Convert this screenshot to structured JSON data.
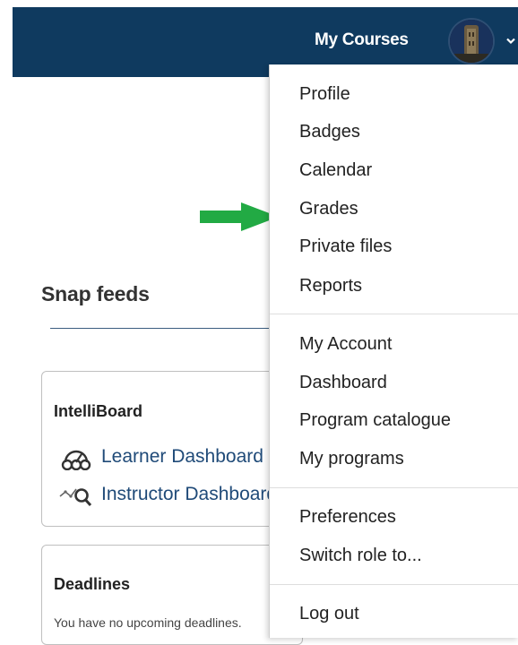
{
  "header": {
    "my_courses_label": "My Courses",
    "avatar_icon": "user-avatar",
    "caret_icon": "chevron-down-icon",
    "background": "#0f3a5f"
  },
  "main": {
    "section_title": "Snap feeds",
    "intelliboard": {
      "title": "IntelliBoard",
      "links": [
        {
          "label": "Learner Dashboard",
          "icon": "dashboard-gauge-icon"
        },
        {
          "label": "Instructor Dashboard",
          "icon": "analytics-magnifier-icon"
        }
      ]
    },
    "deadlines": {
      "title": "Deadlines",
      "empty_text": "You have no upcoming deadlines."
    }
  },
  "annotation": {
    "arrow_color": "#22aa44",
    "arrow_icon": "green-arrow-right",
    "points_to": "Grades"
  },
  "user_menu": {
    "groups": [
      [
        "Profile",
        "Badges",
        "Calendar",
        "Grades",
        "Private files",
        "Reports"
      ],
      [
        "My Account",
        "Dashboard",
        "Program catalogue",
        "My programs"
      ],
      [
        "Preferences",
        "Switch role to..."
      ],
      [
        "Log out"
      ]
    ]
  }
}
